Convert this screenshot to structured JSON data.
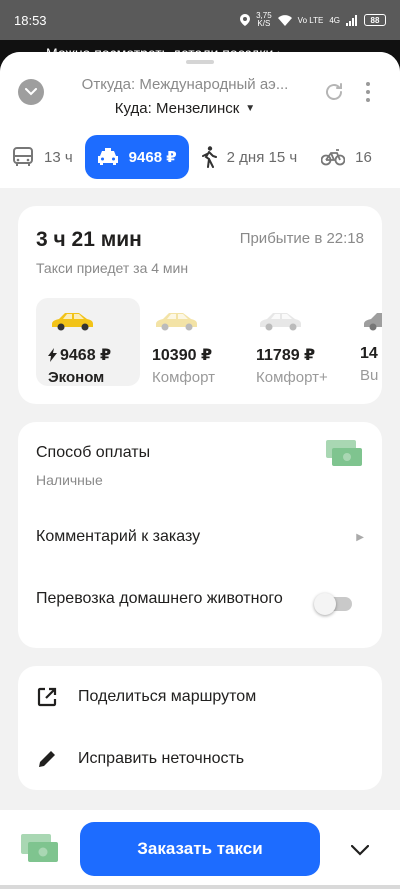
{
  "status_bar": {
    "time": "18:53",
    "speed": "3,75",
    "speed_unit": "K/S",
    "network": "Vo LTE",
    "signal": "4G",
    "battery": "88"
  },
  "banner": {
    "text": "Можно посмотреть детали поездки ›"
  },
  "header": {
    "from": "Откуда: Международный аэ...",
    "to": "Куда: Мензелинск"
  },
  "modes": [
    {
      "icon": "bus-icon",
      "label": "13 ч"
    },
    {
      "icon": "taxi-icon",
      "label": "9468 ₽"
    },
    {
      "icon": "walk-icon",
      "label": "2 дня 15 ч"
    },
    {
      "icon": "bike-icon",
      "label": "16"
    }
  ],
  "trip": {
    "duration": "3 ч 21 мин",
    "arrival": "Прибытие в 22:18",
    "wait": "Такси приедет за 4 мин"
  },
  "tariffs": [
    {
      "price": "9468 ₽",
      "name": "Эконом",
      "color": "#f2c318"
    },
    {
      "price": "10390 ₽",
      "name": "Комфорт",
      "color": "#f3e3a6"
    },
    {
      "price": "11789 ₽",
      "name": "Комфорт+",
      "color": "#e7e7e7"
    },
    {
      "price": "14",
      "name": "Bu",
      "color": "#9e9e9e"
    }
  ],
  "options": {
    "payment_title": "Способ оплаты",
    "payment_value": "Наличные",
    "comment": "Комментарий к заказу",
    "pet_transport": "Перевозка домашнего животного",
    "pet_toggle_on": false
  },
  "actions": {
    "share": "Поделиться маршрутом",
    "fix": "Исправить неточность"
  },
  "bottom": {
    "order": "Заказать такси"
  },
  "colors": {
    "accent": "#1d6cff",
    "cash": "#7fc48f"
  }
}
